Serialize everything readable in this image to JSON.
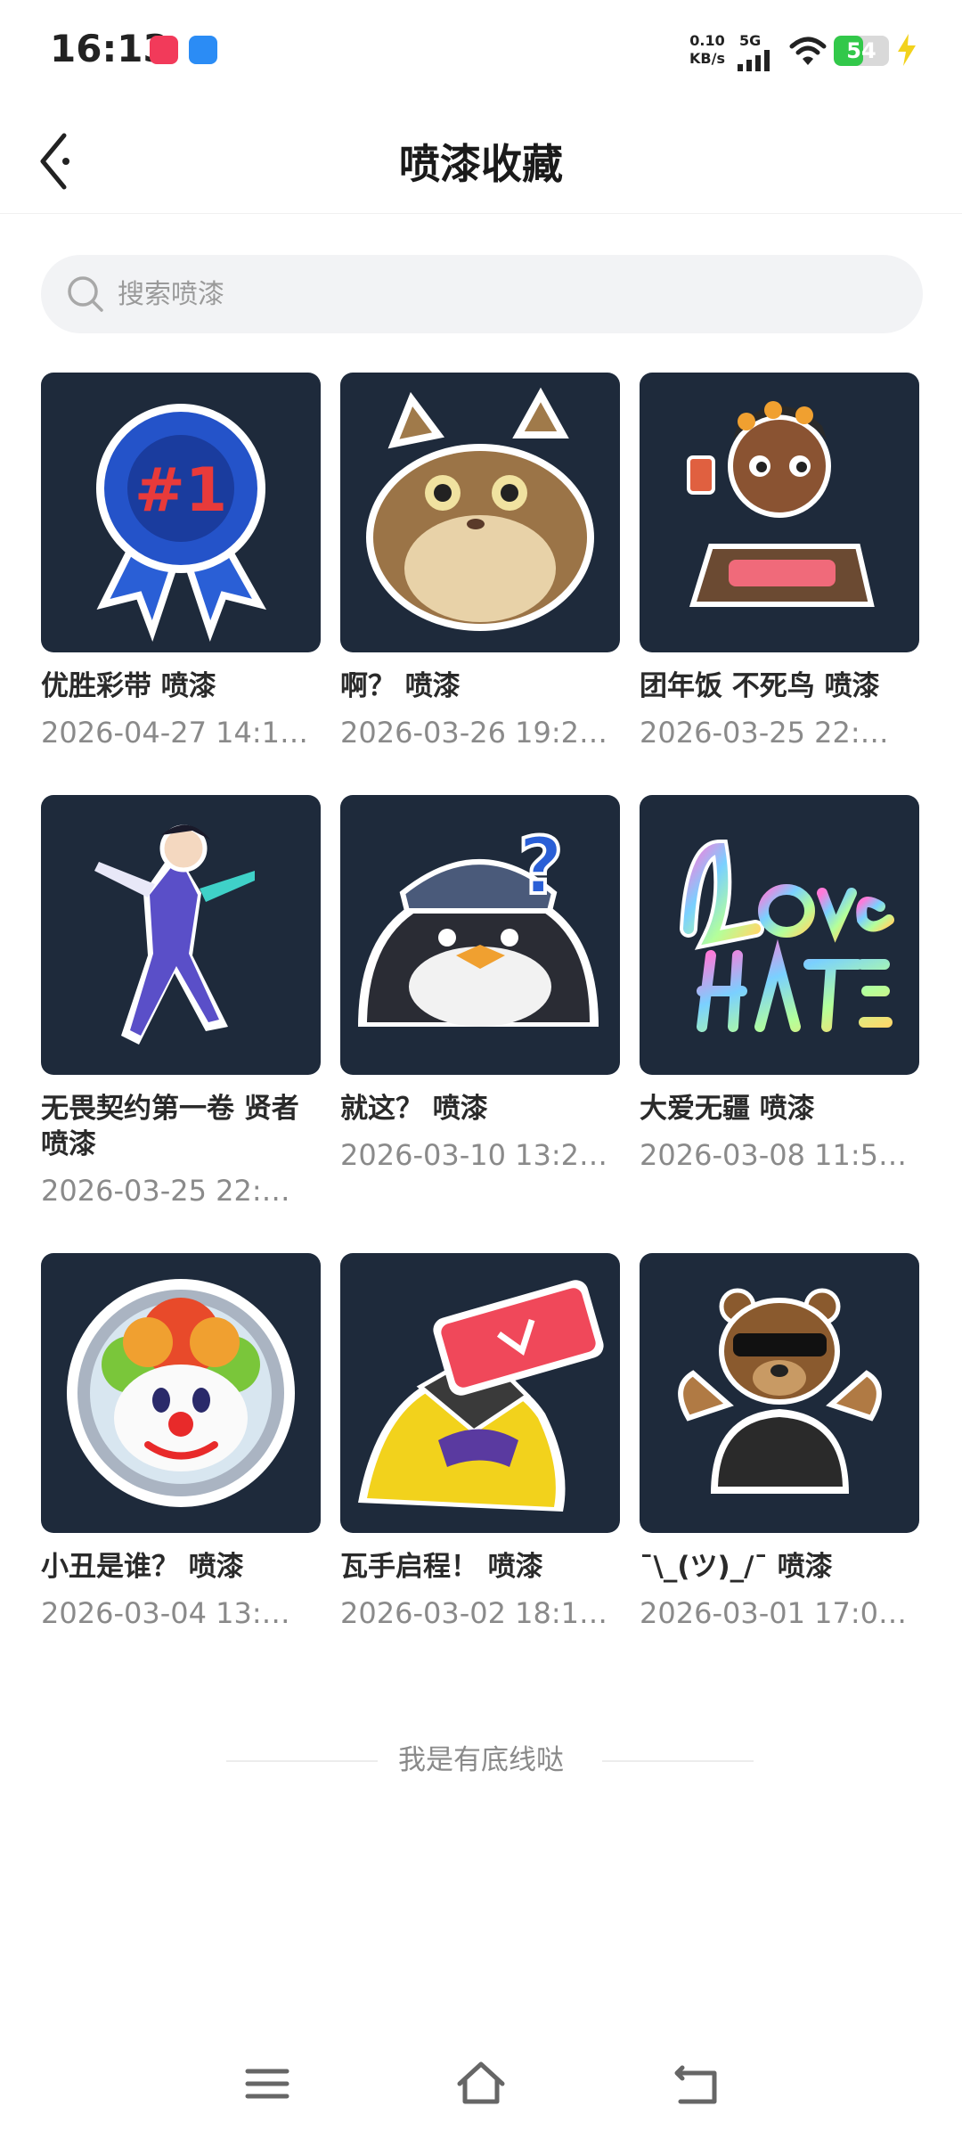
{
  "status_bar": {
    "time": "16:13",
    "net_speed_value": "0.10",
    "net_speed_unit": "KB/s",
    "network": "5G",
    "battery": "54",
    "battery_level": 0.54
  },
  "header": {
    "title": "喷漆收藏"
  },
  "search": {
    "placeholder": "搜索喷漆"
  },
  "sprays": [
    {
      "title": "优胜彩带 喷漆",
      "date": "2026-04-27 14:1…",
      "icon": "blue-rosette-ribbon"
    },
    {
      "title": "啊？ 喷漆",
      "date": "2026-03-26 19:2…",
      "icon": "fat-cat"
    },
    {
      "title": "团年饭 不死鸟 喷漆",
      "date": "2026-03-25 22:…",
      "icon": "character-hotpot-dinner"
    },
    {
      "title": "无畏契约第一卷 贤者 喷漆",
      "date": "2026-03-25 22:…",
      "icon": "sage-agent-figure"
    },
    {
      "title": "就这？ 喷漆",
      "date": "2026-03-10 13:2…",
      "icon": "penguin-question"
    },
    {
      "title": "大爱无疆 喷漆",
      "date": "2026-03-08 11:5…",
      "icon": "love-over-hate-text"
    },
    {
      "title": "小丑是谁？ 喷漆",
      "date": "2026-03-04 13:…",
      "icon": "clown-mirror"
    },
    {
      "title": "瓦手启程！ 喷漆",
      "date": "2026-03-02 18:1…",
      "icon": "bird-phone"
    },
    {
      "title": "¯\\_(ツ)_/¯ 喷漆",
      "date": "2026-03-01 17:0…",
      "icon": "shrugging-bear"
    }
  ],
  "footer": {
    "text": "我是有底线哒"
  },
  "colors": {
    "thumb_bg": "#1e2a3b",
    "search_bg": "#f2f3f5",
    "battery_green": "#32c84a"
  }
}
